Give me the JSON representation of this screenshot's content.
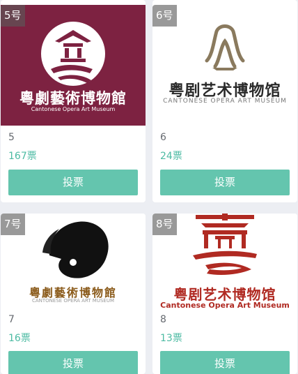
{
  "cards": [
    {
      "badge": "5号",
      "name": "5",
      "votes": "167票",
      "vote_label": "投票",
      "logo_title": "粵劇藝術博物館",
      "logo_subtitle": "Cantonese Opera Art Museum"
    },
    {
      "badge": "6号",
      "name": "6",
      "votes": "24票",
      "vote_label": "投票",
      "logo_title": "粤剧艺术博物馆",
      "logo_subtitle": "CANTONESE OPERA ART MUSEUM"
    },
    {
      "badge": "7号",
      "name": "7",
      "votes": "16票",
      "vote_label": "投票",
      "logo_title": "粵劇藝術博物館",
      "logo_subtitle": "CANTONESE OPERA ART MUSEUM"
    },
    {
      "badge": "8号",
      "name": "8",
      "votes": "13票",
      "vote_label": "投票",
      "logo_title": "粤剧艺术博物馆",
      "logo_subtitle": "Cantonese Opera Art Museum"
    }
  ],
  "colors": {
    "accent": "#64c5ae",
    "votes": "#4dbba3",
    "logo5_bg": "#7d2241",
    "logo8_red": "#b02a22"
  }
}
